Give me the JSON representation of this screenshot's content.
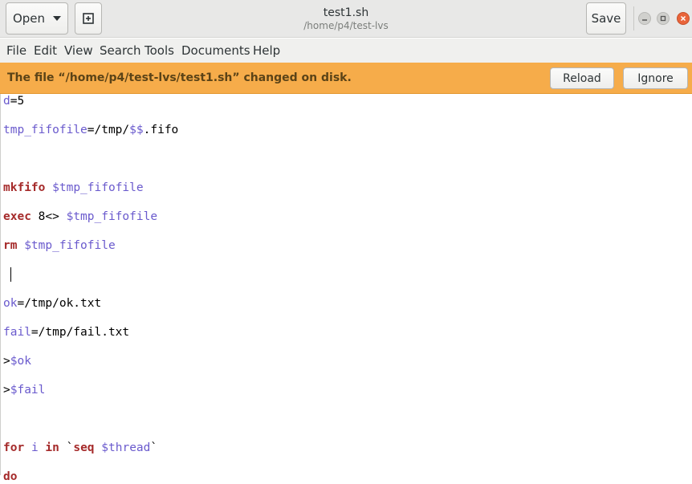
{
  "header": {
    "open_label": "Open",
    "save_label": "Save",
    "title": "test1.sh",
    "subtitle": "/home/p4/test-lvs"
  },
  "menu": [
    "File",
    "Edit",
    "View",
    "Search",
    "Tools",
    "Documents",
    "Help"
  ],
  "infobar": {
    "message": "The file “/home/p4/test-lvs/test1.sh” changed on disk.",
    "reload_label": "Reload",
    "ignore_label": "Ignore",
    "color": "#f6ac4a"
  },
  "editor": {
    "lines": {
      "l1": {
        "a": "d",
        "b": "=5"
      },
      "l3": {
        "a": "tmp_fifofile",
        "b": "=/tmp/",
        "c": "$$",
        "d": ".fifo"
      },
      "l6": {
        "a": "mkfifo",
        "b": " ",
        "c": "$tmp_fifofile"
      },
      "l7": {
        "a": "exec",
        "b": " 8<> ",
        "c": "$tmp_fifofile"
      },
      "l8": {
        "a": "rm",
        "b": " ",
        "c": "$tmp_fifofile"
      },
      "l10": {
        "a": "ok",
        "b": "=/tmp/ok.txt"
      },
      "l11": {
        "a": "fail",
        "b": "=/tmp/fail.txt"
      },
      "l12": {
        "a": ">",
        "b": "$ok"
      },
      "l13": {
        "a": ">",
        "b": "$fail"
      },
      "l16": {
        "a": "for",
        "b": " ",
        "c": "i",
        "d": " ",
        "e": "in",
        "f": " `",
        "g": "seq",
        "h": " ",
        "i": "$thread",
        "j": "`"
      },
      "l17": {
        "a": "do"
      }
    }
  }
}
